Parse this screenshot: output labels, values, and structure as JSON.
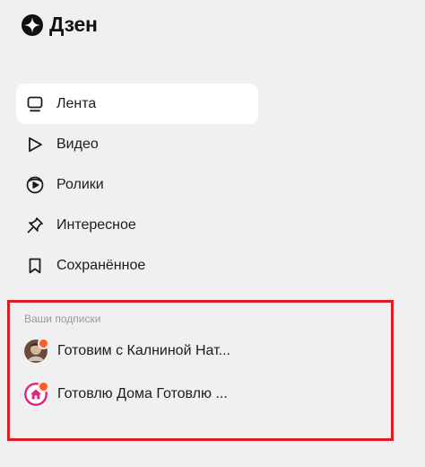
{
  "brand": {
    "name": "Дзен",
    "icon": "dzen-logo-icon"
  },
  "nav": {
    "items": [
      {
        "label": "Лента",
        "icon": "feed-icon",
        "active": true
      },
      {
        "label": "Видео",
        "icon": "play-icon",
        "active": false
      },
      {
        "label": "Ролики",
        "icon": "shorts-icon",
        "active": false
      },
      {
        "label": "Интересное",
        "icon": "pin-icon",
        "active": false
      },
      {
        "label": "Сохранённое",
        "icon": "bookmark-icon",
        "active": false
      }
    ]
  },
  "subscriptions": {
    "title": "Ваши подписки",
    "items": [
      {
        "label": "Готовим с Калниной Нат...",
        "avatar": "chef-photo-avatar",
        "has_update": true
      },
      {
        "label": "Готовлю Дома Готовлю ...",
        "avatar": "house-logo-avatar",
        "has_update": true
      }
    ]
  },
  "colors": {
    "background": "#f0f0f0",
    "active_item": "#ffffff",
    "highlight_border": "#e11b24",
    "update_dot": "#ff5a1f",
    "house_avatar": "#e3237d"
  }
}
